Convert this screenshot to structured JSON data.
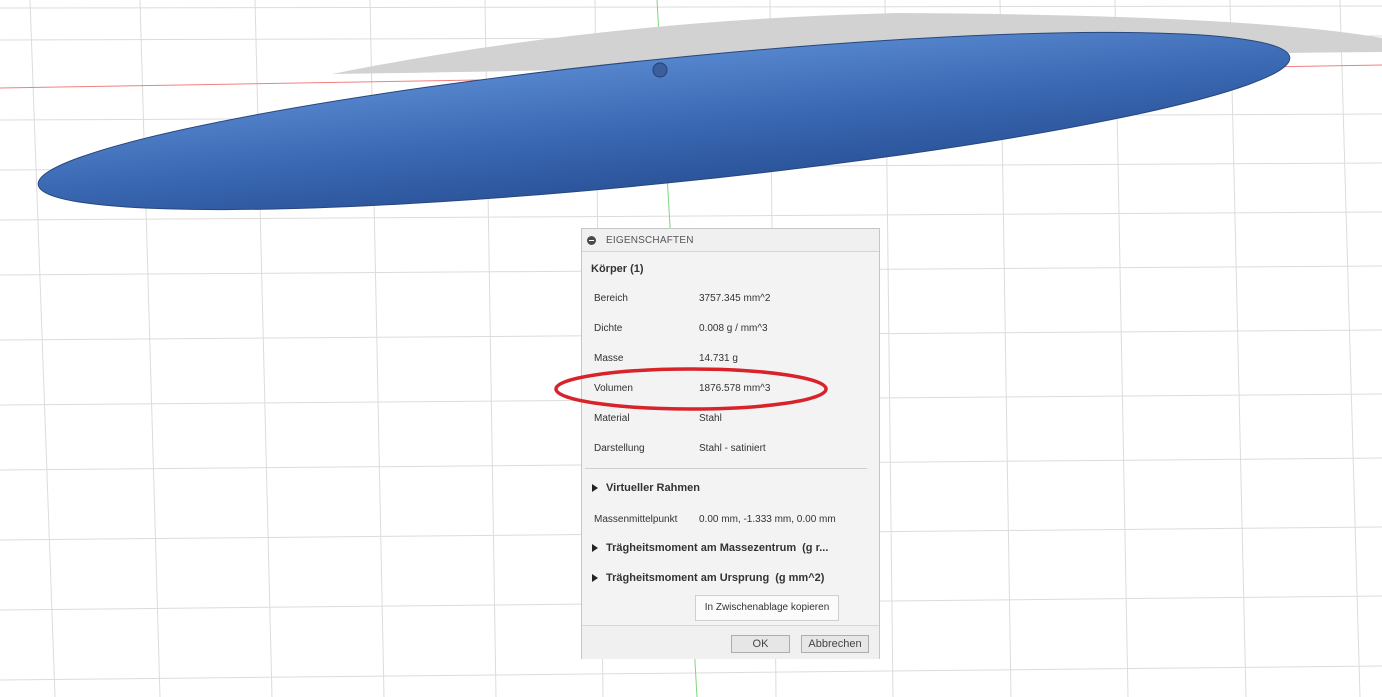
{
  "dialog": {
    "title": "EIGENSCHAFTEN",
    "body_heading": "Körper (1)",
    "properties": [
      {
        "label": "Bereich",
        "value": "3757.345 mm^2"
      },
      {
        "label": "Dichte",
        "value": "0.008 g / mm^3"
      },
      {
        "label": "Masse",
        "value": "14.731 g"
      },
      {
        "label": "Volumen",
        "value": "1876.578 mm^3"
      },
      {
        "label": "Material",
        "value": "Stahl"
      },
      {
        "label": "Darstellung",
        "value": "Stahl - satiniert"
      }
    ],
    "sections": {
      "virtual_frame": "Virtueller Rahmen",
      "inertia_center": {
        "label": "Trägheitsmoment am Massezentrum",
        "unit": "(g r..."
      },
      "inertia_origin": {
        "label": "Trägheitsmoment am Ursprung",
        "unit": "(g mm^2)"
      }
    },
    "center_of_mass": {
      "label": "Massenmittelpunkt",
      "value": "0.00 mm, -1.333 mm, 0.00 mm"
    },
    "copy_button": "In Zwischenablage kopieren",
    "ok_button": "OK",
    "cancel_button": "Abbrechen"
  },
  "colors": {
    "body_blue": "#3462ad",
    "ghost_gray": "#d2d2d2",
    "highlight_red": "#d8232a",
    "axis_red": "#f08080",
    "axis_green": "#7fd67f",
    "grid": "#dadada"
  }
}
